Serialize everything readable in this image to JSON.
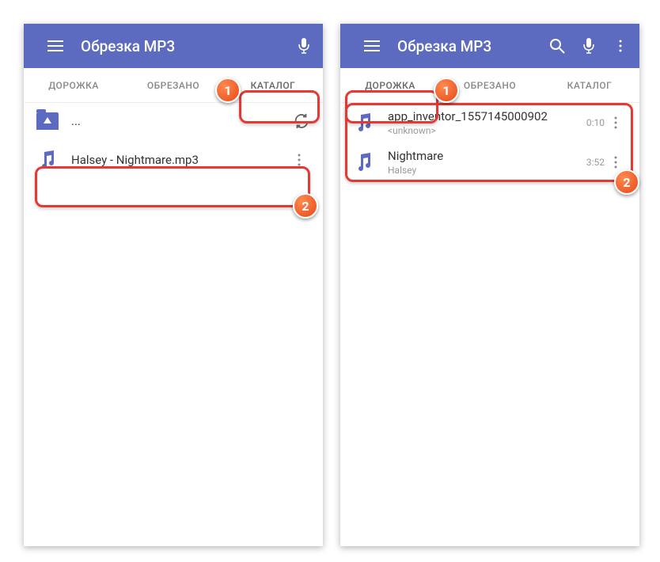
{
  "app": {
    "title": "Обрезка MP3"
  },
  "tabs": {
    "track": "ДОРОЖКА",
    "cut": "ОБРЕЗАНО",
    "catalog": "КАТАЛОГ"
  },
  "left": {
    "folder_up": "...",
    "track": {
      "title": "Halsey - Nightmare.mp3"
    }
  },
  "right": {
    "tracks": [
      {
        "title": "app_inventor_1557145000902",
        "artist": "<unknown>",
        "duration": "0:10"
      },
      {
        "title": "Nightmare",
        "artist": "Halsey",
        "duration": "3:52"
      }
    ]
  },
  "badges": {
    "one": "1",
    "two": "2"
  }
}
